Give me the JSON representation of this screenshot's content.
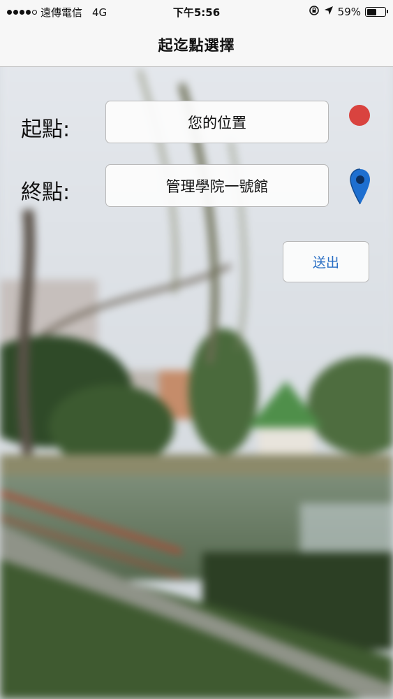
{
  "status_bar": {
    "carrier": "遠傳電信",
    "network": "4G",
    "time": "下午5:56",
    "battery_text": "59%",
    "battery_level": 0.59,
    "signal_bars_filled": 4,
    "signal_bars_total": 5
  },
  "nav": {
    "title": "起迄點選擇"
  },
  "form": {
    "start_label": "起點:",
    "start_value": "您的位置",
    "end_label": "終點:",
    "end_value": "管理學院一號館",
    "submit_label": "送出"
  },
  "colors": {
    "start_marker": "#d9433f",
    "end_marker": "#1e6fd0",
    "button_text": "#2a6fc4"
  },
  "icons": {
    "start_marker": "red-dot-icon",
    "end_marker": "map-pin-icon",
    "rotation_lock": "rotation-lock-icon",
    "location": "location-arrow-icon",
    "battery": "battery-icon"
  }
}
